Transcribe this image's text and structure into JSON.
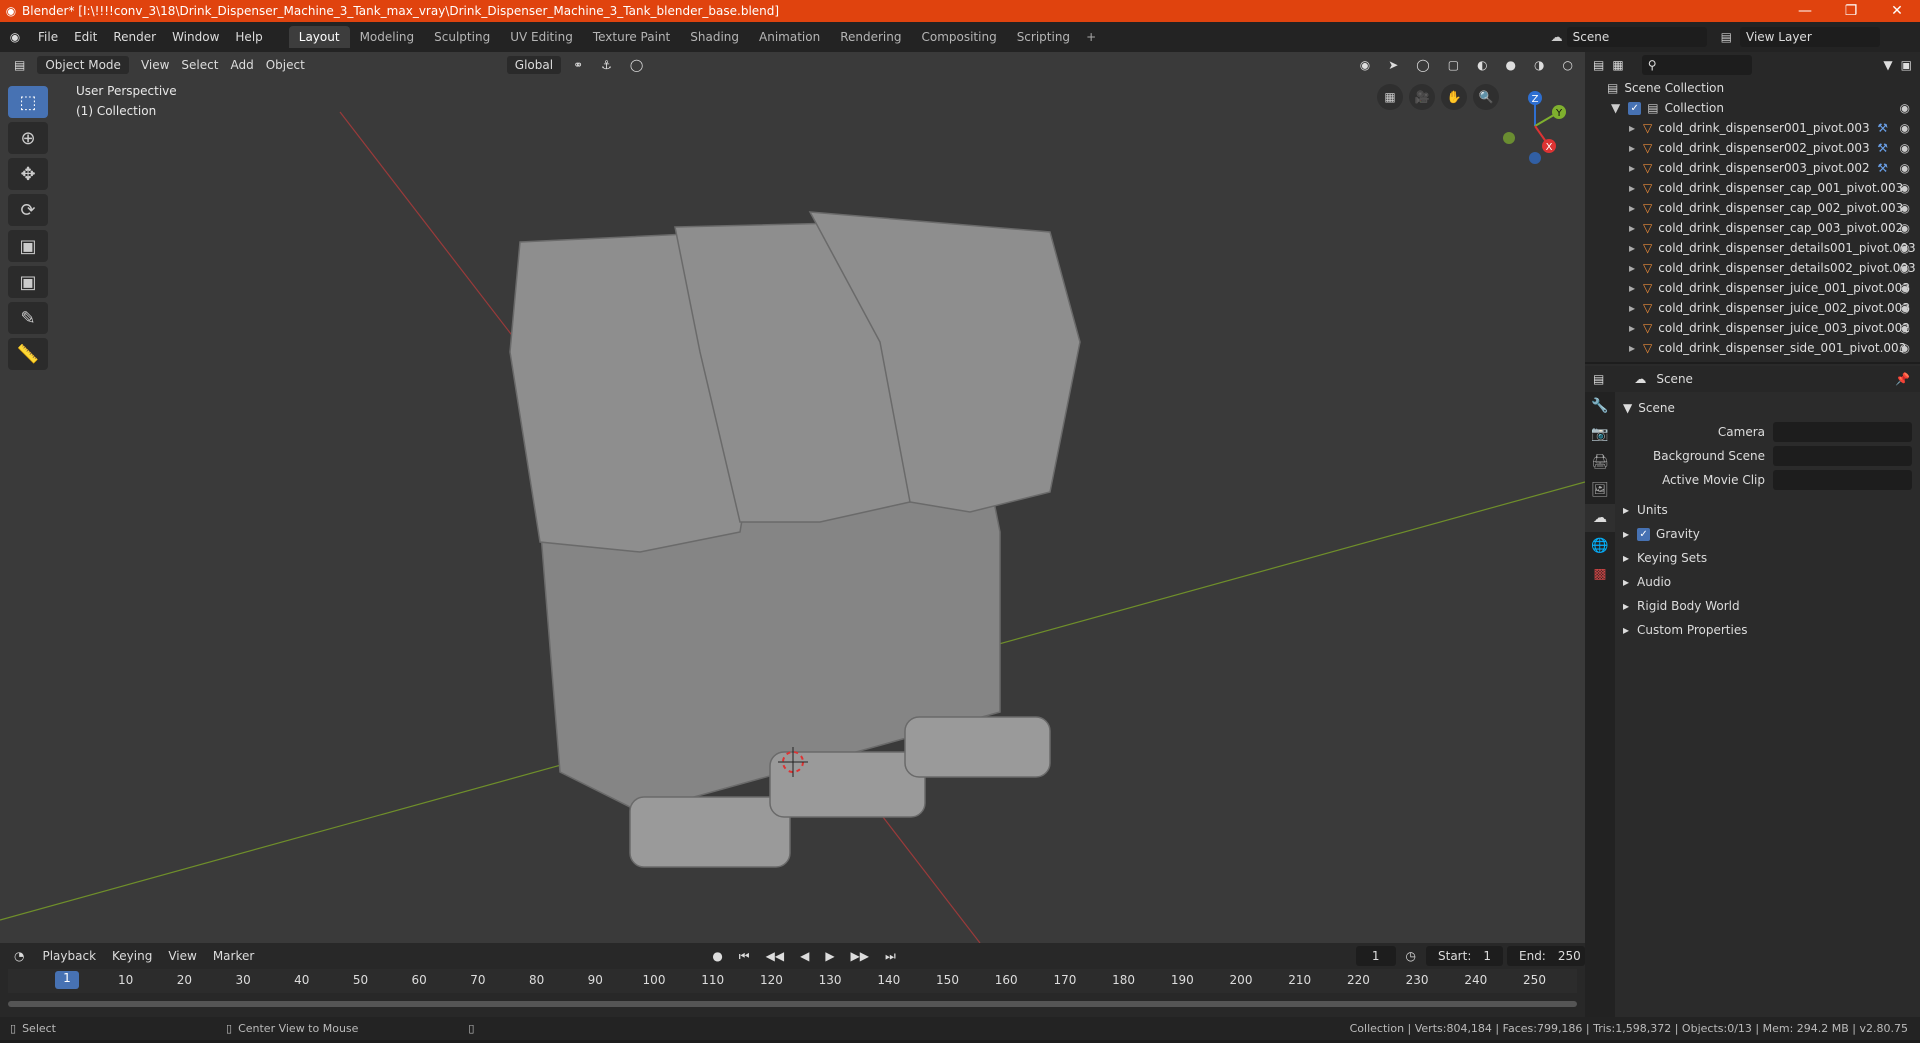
{
  "title_bar": {
    "text": "Blender* [I:\\!!!!conv_3\\18\\Drink_Dispenser_Machine_3_Tank_max_vray\\Drink_Dispenser_Machine_3_Tank_blender_base.blend]",
    "minimize": "—",
    "maximize": "❐",
    "close": "✕"
  },
  "menu": [
    "File",
    "Edit",
    "Render",
    "Window",
    "Help"
  ],
  "workspaces": [
    "Layout",
    "Modeling",
    "Sculpting",
    "UV Editing",
    "Texture Paint",
    "Shading",
    "Animation",
    "Rendering",
    "Compositing",
    "Scripting"
  ],
  "scene_field": "Scene",
  "view_layer_field": "View Layer",
  "viewport": {
    "mode": "Object Mode",
    "menus": [
      "View",
      "Select",
      "Add",
      "Object"
    ],
    "transform": "Global",
    "overlay_title": "User Perspective",
    "overlay_collection": "(1) Collection",
    "gizmo": {
      "x": "X",
      "y": "Y",
      "z": "Z"
    }
  },
  "outliner": {
    "root": "Scene Collection",
    "collection": "Collection",
    "items": [
      {
        "name": "cold_drink_dispenser001_pivot.003",
        "mod": true
      },
      {
        "name": "cold_drink_dispenser002_pivot.003",
        "mod": true
      },
      {
        "name": "cold_drink_dispenser003_pivot.002",
        "mod": true
      },
      {
        "name": "cold_drink_dispenser_cap_001_pivot.003",
        "mod": false
      },
      {
        "name": "cold_drink_dispenser_cap_002_pivot.003",
        "mod": false
      },
      {
        "name": "cold_drink_dispenser_cap_003_pivot.002",
        "mod": false
      },
      {
        "name": "cold_drink_dispenser_details001_pivot.003",
        "mod": false
      },
      {
        "name": "cold_drink_dispenser_details002_pivot.003",
        "mod": false
      },
      {
        "name": "cold_drink_dispenser_juice_001_pivot.003",
        "mod": false
      },
      {
        "name": "cold_drink_dispenser_juice_002_pivot.003",
        "mod": false
      },
      {
        "name": "cold_drink_dispenser_juice_003_pivot.002",
        "mod": false
      },
      {
        "name": "cold_drink_dispenser_side_001_pivot.003",
        "mod": false
      }
    ]
  },
  "properties": {
    "header": "Scene",
    "section": "Scene",
    "camera_label": "Camera",
    "background_label": "Background Scene",
    "movie_clip_label": "Active Movie Clip",
    "subsections": [
      "Units",
      "Gravity",
      "Keying Sets",
      "Audio",
      "Rigid Body World",
      "Custom Properties"
    ]
  },
  "timeline": {
    "menus": [
      "Playback",
      "Keying",
      "View",
      "Marker"
    ],
    "current_frame": "1",
    "start_label": "Start:",
    "start": "1",
    "end_label": "End:",
    "end": "250",
    "ticks": [
      "10",
      "20",
      "30",
      "40",
      "50",
      "60",
      "70",
      "80",
      "90",
      "100",
      "110",
      "120",
      "130",
      "140",
      "150",
      "160",
      "170",
      "180",
      "190",
      "200",
      "210",
      "220",
      "230",
      "240",
      "250"
    ]
  },
  "status": {
    "select": "Select",
    "center": "Center View to Mouse",
    "stats": "Collection | Verts:804,184 | Faces:799,186 | Tris:1,598,372 | Objects:0/13 | Mem: 294.2 MB | v2.80.75"
  }
}
